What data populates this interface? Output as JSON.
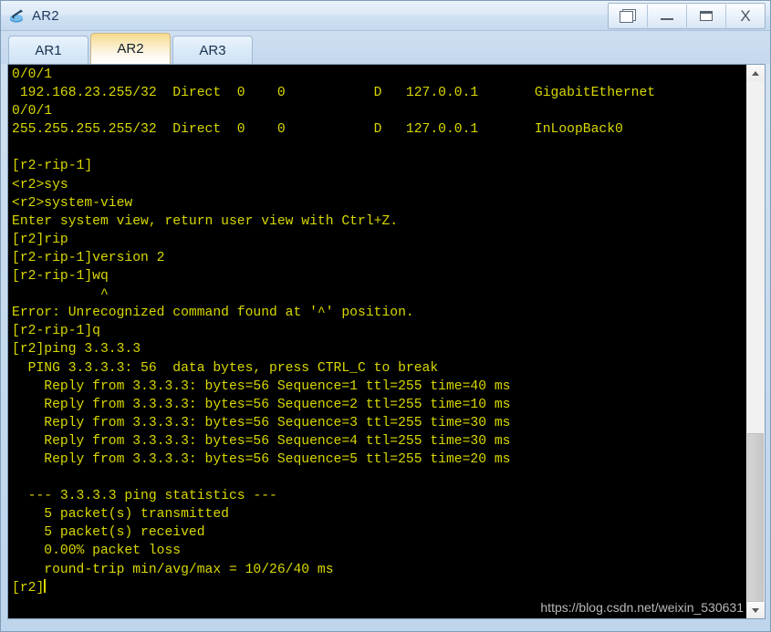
{
  "window": {
    "title": "AR2",
    "icon": "router-icon",
    "controls": [
      {
        "name": "restore-button",
        "glyph": "restore-icon",
        "label": ""
      },
      {
        "name": "minimize-button",
        "glyph": "minimize-icon",
        "label": ""
      },
      {
        "name": "maximize-button",
        "glyph": "maximize-icon",
        "label": ""
      },
      {
        "name": "close-button",
        "glyph": "close-icon",
        "label": "X"
      }
    ]
  },
  "tabs": [
    {
      "label": "AR1",
      "active": false
    },
    {
      "label": "AR2",
      "active": true
    },
    {
      "label": "AR3",
      "active": false
    }
  ],
  "terminal": {
    "foreground_color": "#d8d800",
    "background_color": "#000000",
    "text": "0/0/1\n 192.168.23.255/32  Direct  0    0           D   127.0.0.1       GigabitEthernet\n0/0/1\n255.255.255.255/32  Direct  0    0           D   127.0.0.1       InLoopBack0\n\n[r2-rip-1]\n<r2>sys\n<r2>system-view\nEnter system view, return user view with Ctrl+Z.\n[r2]rip\n[r2-rip-1]version 2\n[r2-rip-1]wq\n           ^\nError: Unrecognized command found at '^' position.\n[r2-rip-1]q\n[r2]ping 3.3.3.3\n  PING 3.3.3.3: 56  data bytes, press CTRL_C to break\n    Reply from 3.3.3.3: bytes=56 Sequence=1 ttl=255 time=40 ms\n    Reply from 3.3.3.3: bytes=56 Sequence=2 ttl=255 time=10 ms\n    Reply from 3.3.3.3: bytes=56 Sequence=3 ttl=255 time=30 ms\n    Reply from 3.3.3.3: bytes=56 Sequence=4 ttl=255 time=30 ms\n    Reply from 3.3.3.3: bytes=56 Sequence=5 ttl=255 time=20 ms\n\n  --- 3.3.3.3 ping statistics ---\n    5 packet(s) transmitted\n    5 packet(s) received\n    0.00% packet loss\n    round-trip min/avg/max = 10/26/40 ms\n",
    "prompt": "[r2]"
  },
  "watermark": "https://blog.csdn.net/weixin_530631",
  "scrollbar": {
    "up_label": "",
    "down_label": ""
  }
}
